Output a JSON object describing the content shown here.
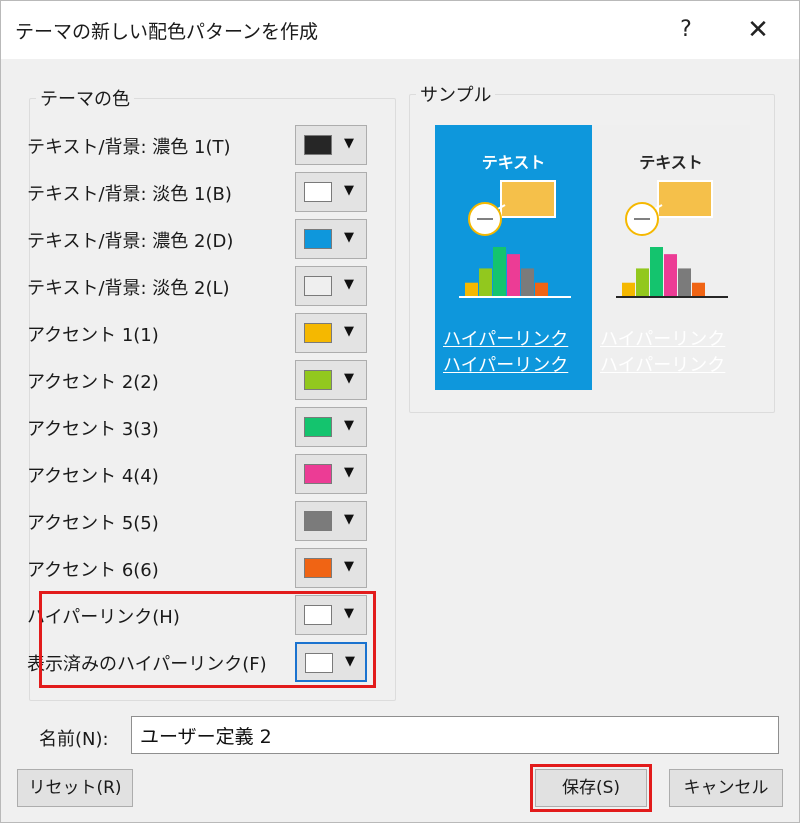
{
  "window": {
    "title": "テーマの新しい配色パターンを作成",
    "help_label": "?",
    "close_label": "✕"
  },
  "theme_colors": {
    "legend": "テーマの色",
    "rows": [
      {
        "label": "テキスト/背景: 濃色 1(T)",
        "color": "#262626"
      },
      {
        "label": "テキスト/背景: 淡色 1(B)",
        "color": "#ffffff"
      },
      {
        "label": "テキスト/背景: 濃色 2(D)",
        "color": "#0e97dc"
      },
      {
        "label": "テキスト/背景: 淡色 2(L)",
        "color": "#efefef"
      },
      {
        "label": "アクセント 1(1)",
        "color": "#f5b800"
      },
      {
        "label": "アクセント 2(2)",
        "color": "#92c81e"
      },
      {
        "label": "アクセント 3(3)",
        "color": "#14c46e"
      },
      {
        "label": "アクセント 4(4)",
        "color": "#ec3c95"
      },
      {
        "label": "アクセント 5(5)",
        "color": "#7b7b7b"
      },
      {
        "label": "アクセント 6(6)",
        "color": "#f06414"
      },
      {
        "label": "ハイパーリンク(H)",
        "color": "#ffffff"
      },
      {
        "label": "表示済みのハイパーリンク(F)",
        "color": "#ffffff"
      }
    ],
    "dropdown_arrow": "▼"
  },
  "sample": {
    "legend": "サンプル",
    "text_label": "テキスト",
    "hyperlink": "ハイパーリンク",
    "visited_hyperlink": "ハイパーリンク",
    "dark_bg": "#0e97dc",
    "light_bg": "#efefef",
    "bar_values": [
      2,
      4,
      7,
      6,
      4,
      2
    ],
    "bar_colors": [
      "#f5b800",
      "#92c81e",
      "#14c46e",
      "#ec3c95",
      "#7b7b7b",
      "#f06414"
    ]
  },
  "name": {
    "label": "名前(N):",
    "value": "ユーザー定義 2"
  },
  "buttons": {
    "reset": "リセット(R)",
    "save": "保存(S)",
    "cancel": "キャンセル"
  },
  "colors": {
    "highlight": "#e21b1b",
    "focus": "#1b73cf"
  }
}
